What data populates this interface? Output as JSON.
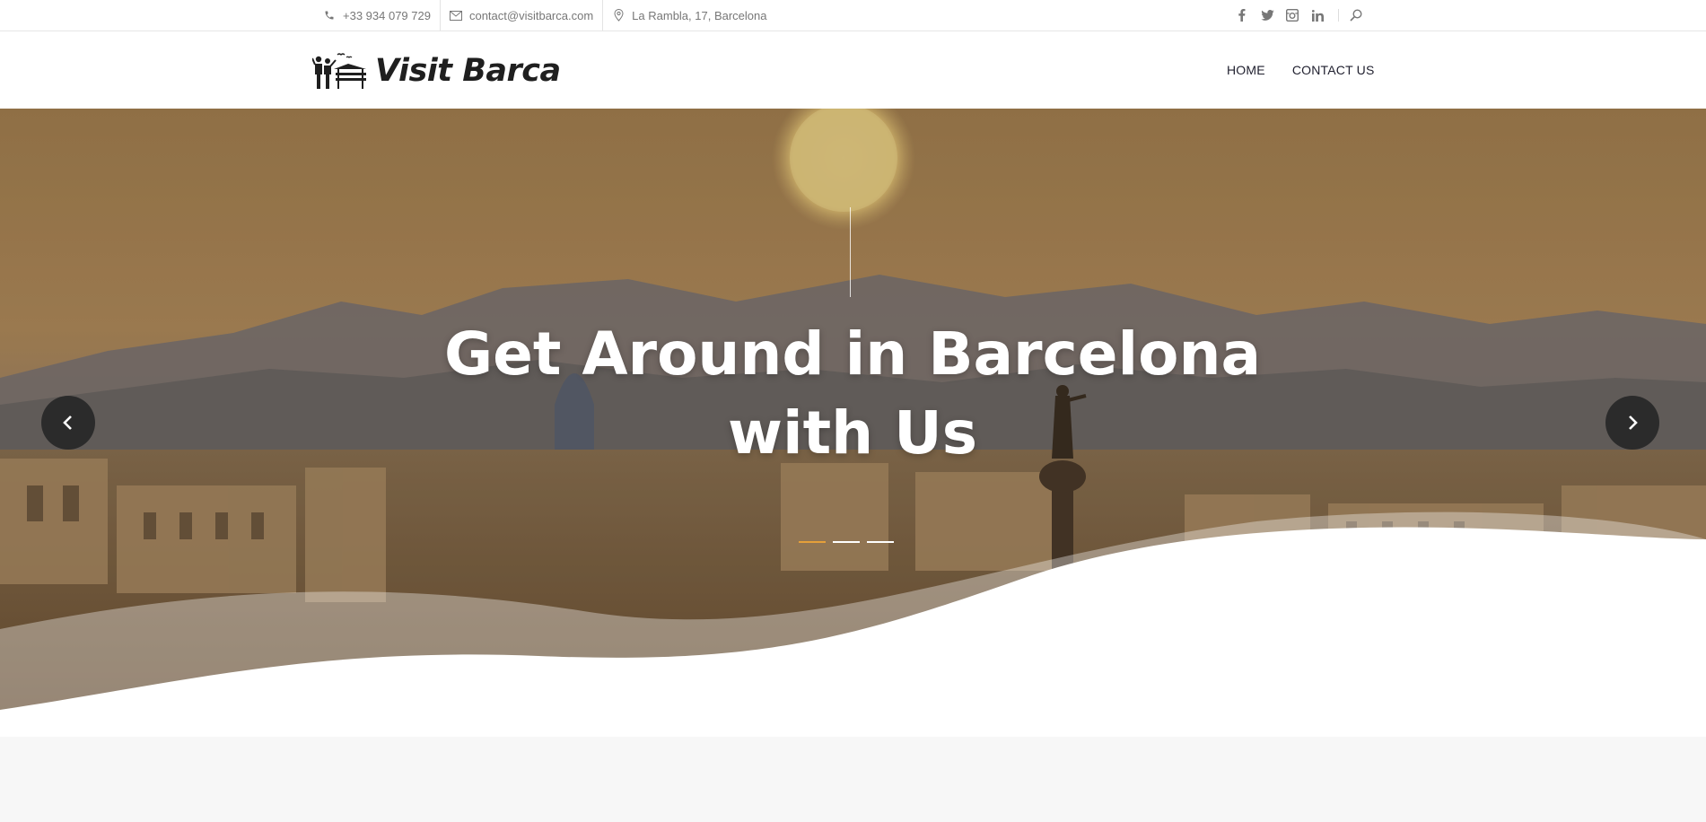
{
  "topbar": {
    "phone": "+33 934 079 729",
    "email": "contact@visitbarca.com",
    "address": "La Rambla, 17, Barcelona",
    "social_icons": [
      "facebook-icon",
      "twitter-icon",
      "instagram-icon",
      "linkedin-icon"
    ],
    "search_icon": "search-icon"
  },
  "header": {
    "logo_text": "Visit Barca",
    "nav": [
      {
        "label": "HOME"
      },
      {
        "label": "CONTACT US"
      }
    ]
  },
  "hero": {
    "title_line1": "Get Around in Barcelona",
    "title_line2": "with Us",
    "slides_count": 3,
    "active_slide": 1,
    "prev_icon": "chevron-left-icon",
    "next_icon": "chevron-right-icon"
  },
  "colors": {
    "accent": "#e5a03a",
    "arrow_bg": "#2b2b2b",
    "text_dark": "#1f1f2e"
  }
}
